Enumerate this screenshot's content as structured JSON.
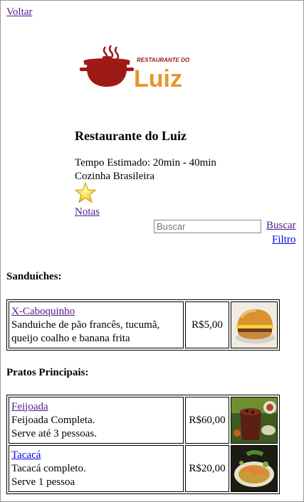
{
  "nav": {
    "back_label": "Voltar"
  },
  "restaurant": {
    "logo_small_text": "RESTAURANTE DO",
    "logo_big_text": "Luiz",
    "name": "Restaurante do Luiz",
    "estimated_time": "Tempo Estimado: 20min - 40min",
    "cuisine": "Cozinha Brasileira",
    "rating_link": "Notas"
  },
  "search": {
    "placeholder": "Buscar",
    "button_label": "Buscar",
    "filter_label": "Filtro"
  },
  "sections": [
    {
      "title": "Sanduíches:",
      "items": [
        {
          "name": "X-Caboquinho",
          "desc1": "Sanduiche de pão francês, tucumã,",
          "desc2": "queijo coalho e banana frita",
          "price": "R$5,00",
          "image": "sandwich-photo"
        }
      ]
    },
    {
      "title": "Pratos Principais:",
      "items": [
        {
          "name": "Feijoada",
          "desc1": "Feijoada Completa.",
          "desc2": "Serve até 3 pessoas.",
          "price": "R$60,00",
          "image": "feijoada-photo"
        },
        {
          "name": "Tacacá",
          "desc1": "Tacacá completo.",
          "desc2": "Serve 1 pessoa",
          "price": "R$20,00",
          "image": "tacaca-photo"
        }
      ]
    }
  ],
  "colors": {
    "logo_red": "#9e1a17",
    "logo_orange": "#e8952a",
    "visited_link": "#551a8b",
    "link": "#0000ee"
  }
}
